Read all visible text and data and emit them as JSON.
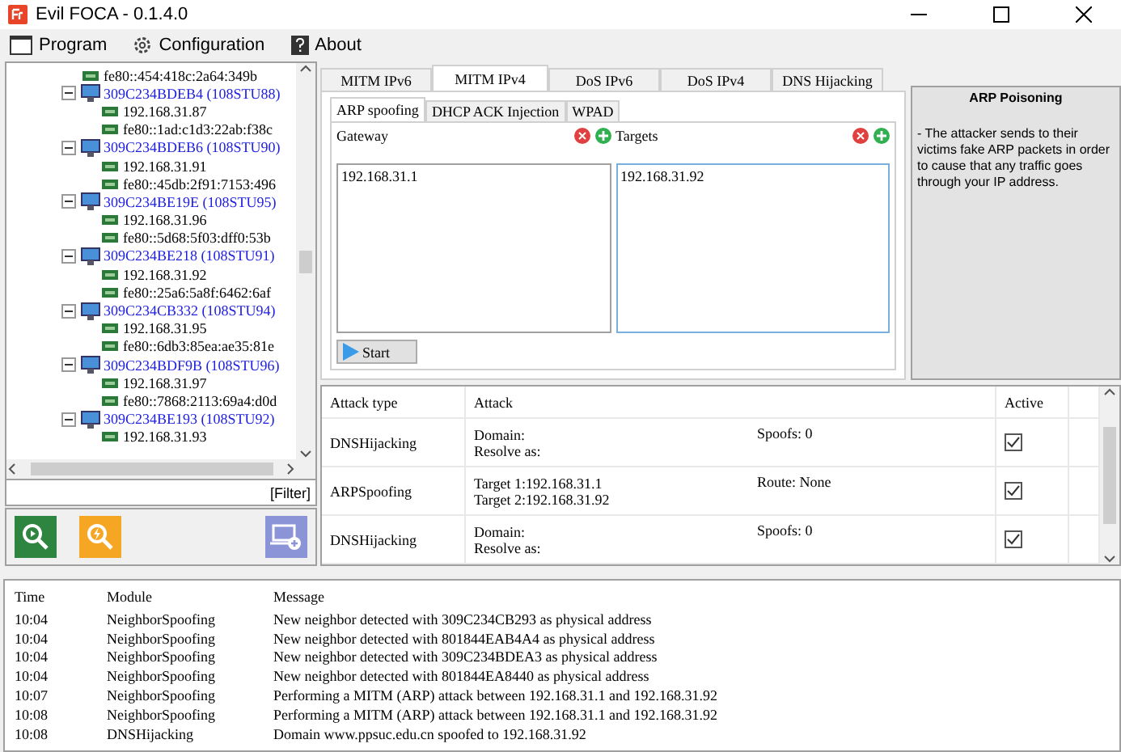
{
  "window": {
    "title": "Evil FOCA - 0.1.4.0"
  },
  "menu": [
    {
      "label": "Program",
      "kind": "window"
    },
    {
      "label": "Configuration",
      "kind": "gear"
    },
    {
      "label": "About",
      "kind": "help"
    }
  ],
  "tree": [
    {
      "kind": "address",
      "label": "fe80::454:418c:2a64:349b"
    },
    {
      "kind": "host",
      "label": "309C234BDEB4 (108STU88)",
      "expanded": true,
      "children": [
        {
          "kind": "address",
          "label": "192.168.31.87"
        },
        {
          "kind": "address",
          "label": "fe80::1ad:c1d3:22ab:f38c"
        }
      ]
    },
    {
      "kind": "host",
      "label": "309C234BDEB6 (108STU90)",
      "expanded": true,
      "children": [
        {
          "kind": "address",
          "label": "192.168.31.91"
        },
        {
          "kind": "address",
          "label": "fe80::45db:2f91:7153:496"
        }
      ]
    },
    {
      "kind": "host",
      "label": "309C234BE19E (108STU95)",
      "expanded": true,
      "children": [
        {
          "kind": "address",
          "label": "192.168.31.96"
        },
        {
          "kind": "address",
          "label": "fe80::5d68:5f03:dff0:53b"
        }
      ]
    },
    {
      "kind": "host",
      "label": "309C234BE218 (108STU91)",
      "expanded": true,
      "children": [
        {
          "kind": "address",
          "label": "192.168.31.92"
        },
        {
          "kind": "address",
          "label": "fe80::25a6:5a8f:6462:6af"
        }
      ]
    },
    {
      "kind": "host",
      "label": "309C234CB332 (108STU94)",
      "expanded": true,
      "children": [
        {
          "kind": "address",
          "label": "192.168.31.95"
        },
        {
          "kind": "address",
          "label": "fe80::6db3:85ea:ae35:81e"
        }
      ]
    },
    {
      "kind": "host",
      "label": "309C234BDF9B (108STU96)",
      "expanded": true,
      "children": [
        {
          "kind": "address",
          "label": "192.168.31.97"
        },
        {
          "kind": "address",
          "label": "fe80::7868:2113:69a4:d0d"
        }
      ]
    },
    {
      "kind": "host",
      "label": "309C234BE193 (108STU92)",
      "expanded": true,
      "children": [
        {
          "kind": "address",
          "label": "192.168.31.93"
        }
      ]
    }
  ],
  "filter": {
    "label": "[Filter]"
  },
  "tools": [
    {
      "kind": "scan"
    },
    {
      "kind": "attack"
    },
    {
      "kind": "add-host"
    }
  ],
  "tabs": [
    {
      "label": "MITM IPv6",
      "selected": false
    },
    {
      "label": "MITM IPv4",
      "selected": true
    },
    {
      "label": "DoS IPv6",
      "selected": false
    },
    {
      "label": "DoS IPv4",
      "selected": false
    },
    {
      "label": "DNS Hijacking",
      "selected": false
    }
  ],
  "subtabs": [
    {
      "label": "ARP spoofing",
      "selected": true
    },
    {
      "label": "DHCP ACK Injection",
      "selected": false
    },
    {
      "label": "WPAD",
      "selected": false
    }
  ],
  "lists": [
    {
      "label": "Gateway",
      "focused": false,
      "items": [
        "192.168.31.1"
      ]
    },
    {
      "label": "Targets",
      "focused": true,
      "items": [
        "192.168.31.92"
      ]
    }
  ],
  "start_button": "Start",
  "info": {
    "title": "ARP Poisoning",
    "text": "- The attacker sends to their victims fake ARP packets in order to cause that any traffic goes through your IP address."
  },
  "attacks": {
    "columns": [
      "Attack type",
      "Attack",
      "Active"
    ],
    "rows": [
      {
        "type": "DNSHijacking",
        "lines": [
          "Domain:",
          "Resolve as:"
        ],
        "extra": "Spoofs: 0",
        "active": true
      },
      {
        "type": "ARPSpoofing",
        "lines": [
          "Target 1:192.168.31.1",
          "Target 2:192.168.31.92"
        ],
        "extra": "Route: None",
        "active": true
      },
      {
        "type": "DNSHijacking",
        "lines": [
          "Domain:",
          "Resolve as:"
        ],
        "extra": "Spoofs: 0",
        "active": true
      }
    ]
  },
  "log": {
    "columns": [
      "Time",
      "Module",
      "Message"
    ],
    "rows": [
      [
        "10:04",
        "NeighborSpoofing",
        "New neighbor detected with 309C234CB293 as physical address"
      ],
      [
        "10:04",
        "NeighborSpoofing",
        "New neighbor detected with 801844EAB4A4 as physical address"
      ],
      [
        "10:04",
        "NeighborSpoofing",
        "New neighbor detected with 309C234BDEA3 as physical address"
      ],
      [
        "10:04",
        "NeighborSpoofing",
        "New neighbor detected with 801844EA8440 as physical address"
      ],
      [
        "10:07",
        "NeighborSpoofing",
        "Performing a MITM (ARP) attack between 192.168.31.1 and 192.168.31.92"
      ],
      [
        "10:08",
        "NeighborSpoofing",
        "Performing a MITM (ARP) attack between 192.168.31.1 and 192.168.31.92"
      ],
      [
        "10:08",
        "DNSHijacking",
        "Domain www.ppsuc.edu.cn spoofed to 192.168.31.92"
      ]
    ]
  }
}
